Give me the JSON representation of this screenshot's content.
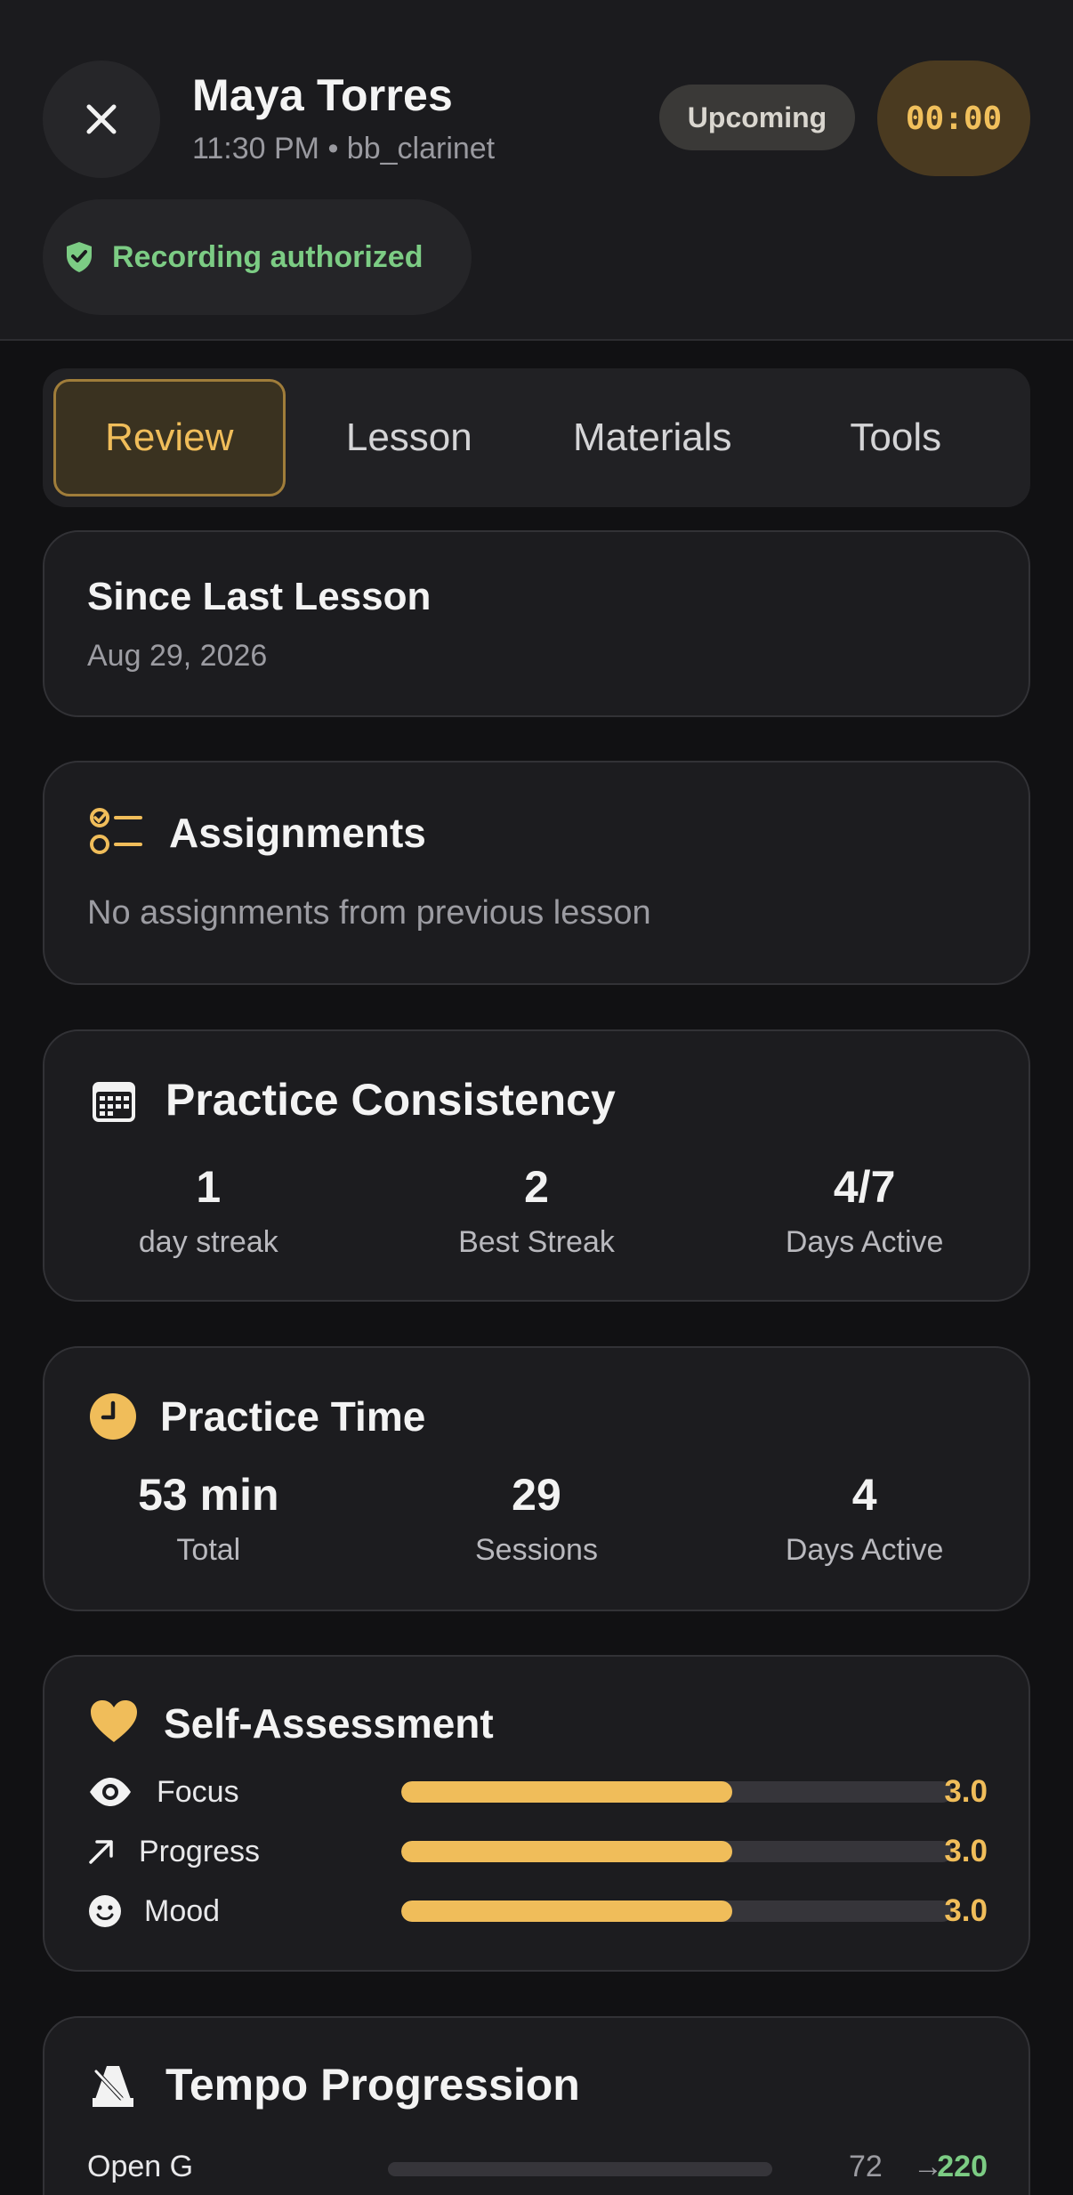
{
  "header": {
    "student_name": "Maya Torres",
    "session_meta": "11:30 PM • bb_clarinet",
    "status": "Upcoming",
    "timer": "00:00",
    "recording_label": "Recording authorized"
  },
  "tabs": [
    {
      "label": "Review",
      "active": true
    },
    {
      "label": "Lesson",
      "active": false
    },
    {
      "label": "Materials",
      "active": false
    },
    {
      "label": "Tools",
      "active": false
    }
  ],
  "since_last": {
    "title": "Since Last Lesson",
    "date": "Aug 29, 2026"
  },
  "assignments": {
    "title": "Assignments",
    "empty_text": "No assignments from previous lesson",
    "icon": "checklist-icon"
  },
  "consistency": {
    "title": "Practice Consistency",
    "icon": "calendar-icon",
    "stats": [
      {
        "value": "1",
        "label": "day streak"
      },
      {
        "value": "2",
        "label": "Best Streak"
      },
      {
        "value": "4/7",
        "label": "Days Active"
      }
    ]
  },
  "practice_time": {
    "title": "Practice Time",
    "icon": "clock-icon",
    "stats": [
      {
        "value": "53 min",
        "label": "Total"
      },
      {
        "value": "29",
        "label": "Sessions"
      },
      {
        "value": "4",
        "label": "Days Active"
      }
    ]
  },
  "self_assessment": {
    "title": "Self-Assessment",
    "icon": "heart-icon",
    "items": [
      {
        "label": "Focus",
        "icon": "eye-icon",
        "score": "3.0",
        "fill_fraction": 0.6
      },
      {
        "label": "Progress",
        "icon": "arrow-up-right-icon",
        "score": "3.0",
        "fill_fraction": 0.6
      },
      {
        "label": "Mood",
        "icon": "smiley-icon",
        "score": "3.0",
        "fill_fraction": 0.6
      }
    ]
  },
  "tempo": {
    "title": "Tempo Progression",
    "icon": "metronome-icon",
    "items": [
      {
        "label": "Open G",
        "from": "72",
        "arrow": "→",
        "to": "220",
        "fill_fraction": 0.0
      }
    ]
  },
  "colors": {
    "accent": "#f0bd5a",
    "success": "#7ccc84",
    "background": "#111113",
    "card": "#1c1c1f"
  }
}
